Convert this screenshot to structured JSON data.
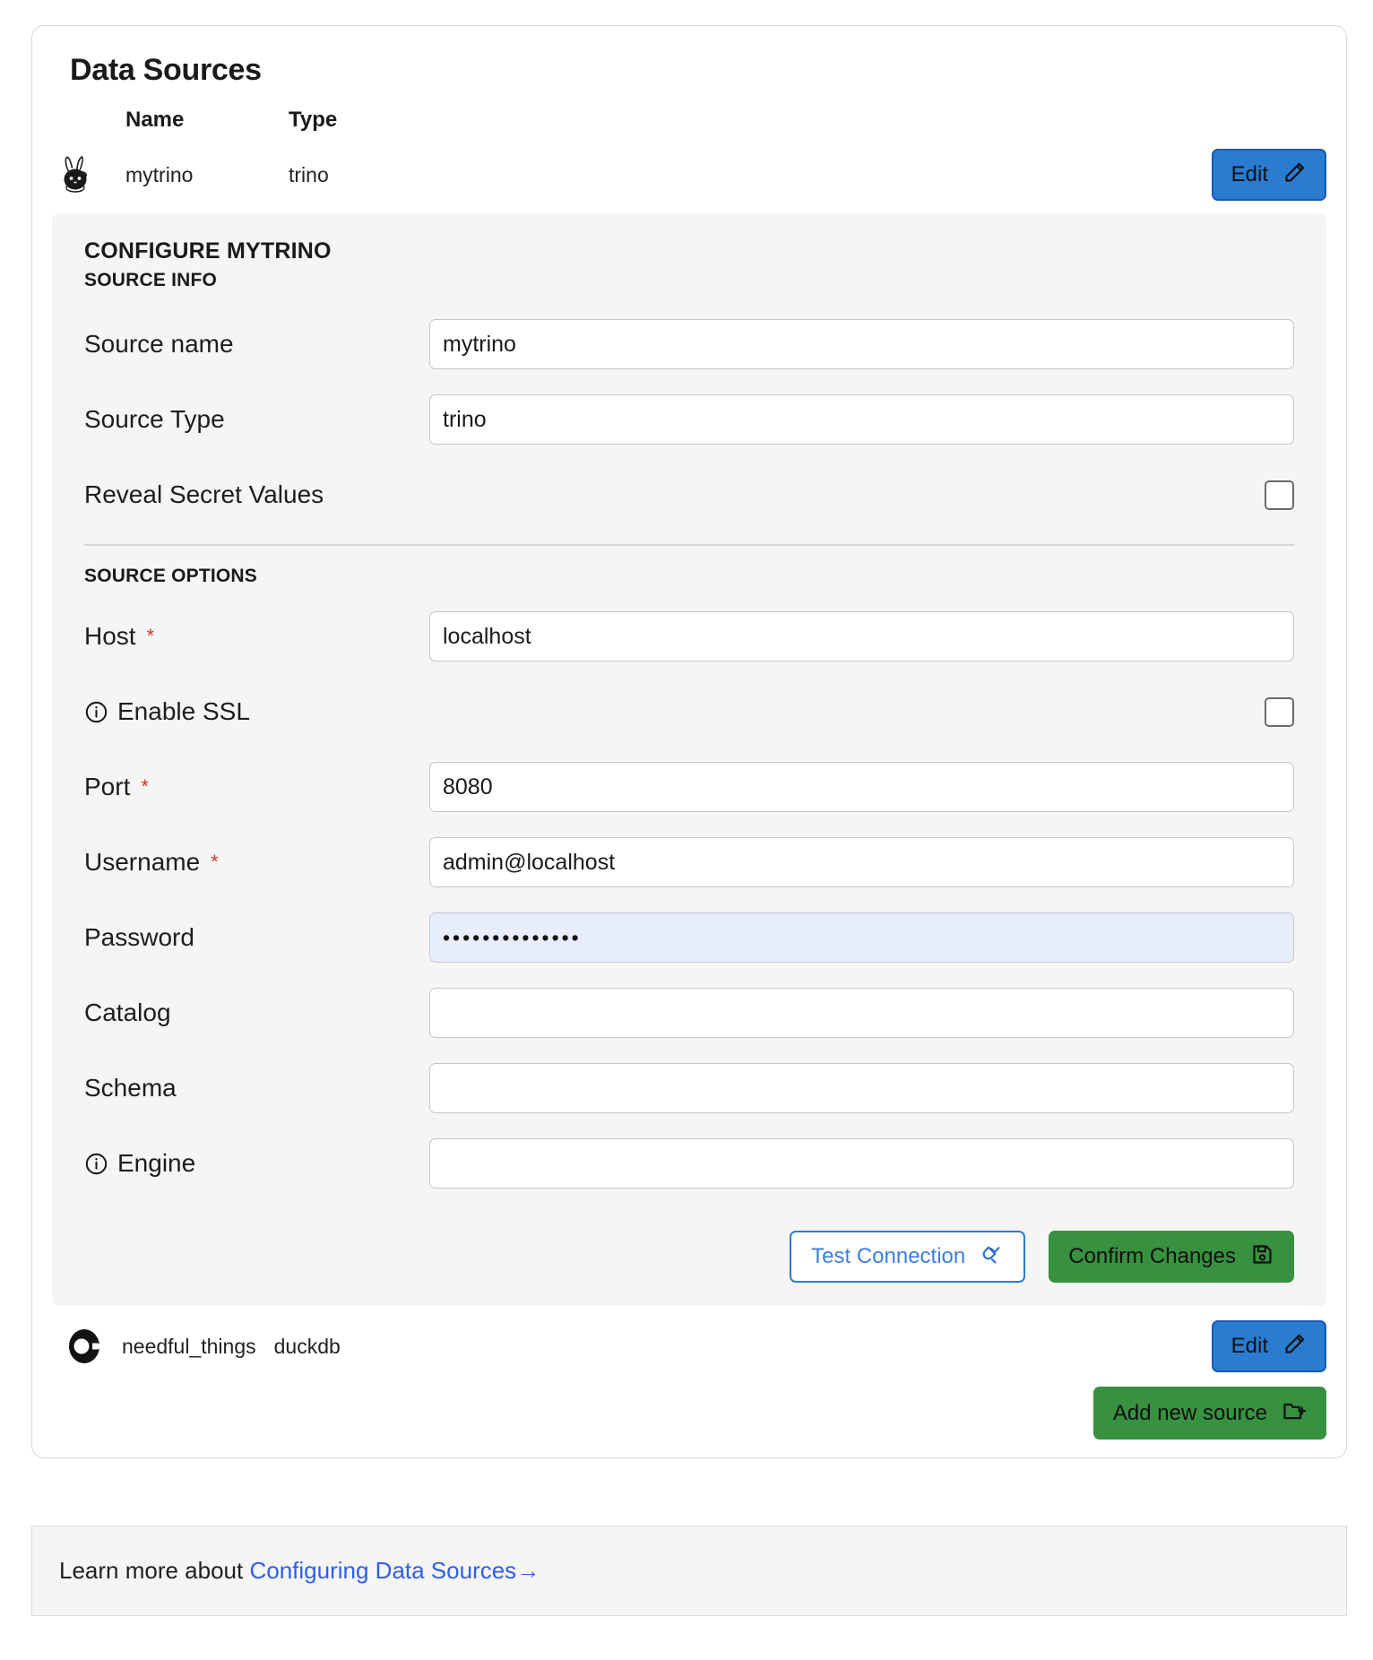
{
  "page": {
    "title": "Data Sources"
  },
  "table": {
    "columns": {
      "name": "Name",
      "type": "Type"
    },
    "rows": [
      {
        "name": "mytrino",
        "type": "trino",
        "logo": "trino-rabbit-icon",
        "edit_label": "Edit"
      },
      {
        "name": "needful_things",
        "type": "duckdb",
        "logo": "duckdb-duck-icon",
        "edit_label": "Edit"
      }
    ]
  },
  "config": {
    "title": "CONFIGURE MYTRINO",
    "source_info_heading": "SOURCE INFO",
    "source_options_heading": "SOURCE OPTIONS",
    "fields": {
      "source_name": {
        "label": "Source name",
        "value": "mytrino"
      },
      "source_type": {
        "label": "Source Type",
        "value": "trino"
      },
      "reveal_secret_values": {
        "label": "Reveal Secret Values",
        "checked": false
      },
      "host": {
        "label": "Host",
        "required": "*",
        "value": "localhost"
      },
      "enable_ssl": {
        "label": "Enable SSL",
        "checked": false,
        "info_icon": "info-icon"
      },
      "port": {
        "label": "Port",
        "required": "*",
        "value": "8080"
      },
      "username": {
        "label": "Username",
        "required": "*",
        "value": "admin@localhost"
      },
      "password": {
        "label": "Password",
        "value": "••••••••••••••"
      },
      "catalog": {
        "label": "Catalog",
        "value": ""
      },
      "schema": {
        "label": "Schema",
        "value": ""
      },
      "engine": {
        "label": "Engine",
        "value": "",
        "info_icon": "info-icon"
      }
    },
    "actions": {
      "test_connection": "Test Connection",
      "confirm_changes": "Confirm Changes"
    }
  },
  "add_new_source_label": "Add new source",
  "footer": {
    "prefix": "Learn more about ",
    "link": "Configuring Data Sources",
    "arrow": "→"
  },
  "colors": {
    "edit_blue": "#2a7cd1",
    "green": "#379140",
    "link_blue": "#2f5ee8",
    "required_red": "#cf3a29",
    "autofill_blue": "#e7edfd",
    "panel_gray": "#f5f5f5"
  }
}
